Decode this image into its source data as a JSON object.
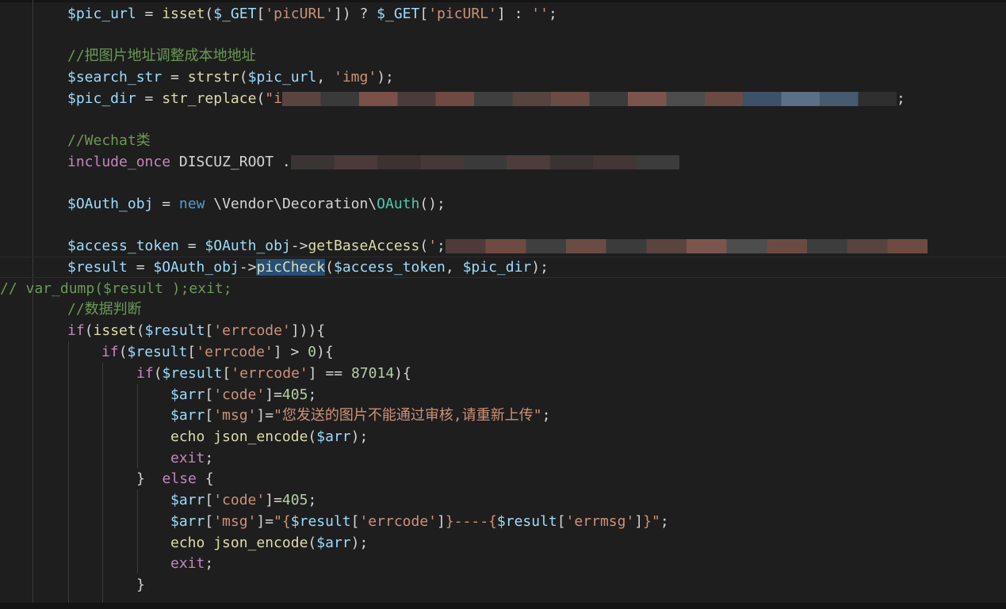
{
  "editor": {
    "theme_colors": {
      "background": "#1e1e1e",
      "variable": "#9cdcfe",
      "function": "#dcdcaa",
      "string": "#ce9178",
      "comment": "#6a9955",
      "keyword": "#569cd6",
      "control": "#c586c0",
      "class": "#4ec9b0",
      "number": "#b5cea8"
    },
    "highlighted_word": "picCheck",
    "lines": [
      {
        "id": "l1",
        "tokens": [
          [
            "v",
            "$pic_url"
          ],
          [
            "p",
            " = "
          ],
          [
            "f",
            "isset"
          ],
          [
            "p",
            "("
          ],
          [
            "v",
            "$_GET"
          ],
          [
            "p",
            "["
          ],
          [
            "s",
            "'picURL'"
          ],
          [
            "p",
            "]) ? "
          ],
          [
            "v",
            "$_GET"
          ],
          [
            "p",
            "["
          ],
          [
            "s",
            "'picURL'"
          ],
          [
            "p",
            "] : "
          ],
          [
            "s",
            "''"
          ],
          [
            "p",
            ";"
          ]
        ]
      },
      {
        "id": "l2",
        "tokens": [
          [
            "c",
            "//把图片地址调整成本地地址"
          ]
        ]
      },
      {
        "id": "l3",
        "tokens": [
          [
            "v",
            "$search_str"
          ],
          [
            "p",
            " = "
          ],
          [
            "f",
            "strstr"
          ],
          [
            "p",
            "("
          ],
          [
            "v",
            "$pic_url"
          ],
          [
            "p",
            ", "
          ],
          [
            "s",
            "'img'"
          ],
          [
            "p",
            ");"
          ]
        ]
      },
      {
        "id": "l4",
        "tokens": [
          [
            "v",
            "$pic_dir"
          ],
          [
            "p",
            " = "
          ],
          [
            "f",
            "str_replace"
          ],
          [
            "p",
            "("
          ],
          [
            "s",
            "\"i"
          ],
          [
            "p",
            ";"
          ]
        ]
      },
      {
        "id": "l5",
        "tokens": [
          [
            "c",
            "//Wechat类"
          ]
        ]
      },
      {
        "id": "l6",
        "tokens": [
          [
            "cf",
            "include_once"
          ],
          [
            "p",
            " DISCUZ_ROOT ."
          ]
        ]
      },
      {
        "id": "l7",
        "tokens": [
          [
            "v",
            "$OAuth_obj"
          ],
          [
            "p",
            " = "
          ],
          [
            "k",
            "new"
          ],
          [
            "p",
            " \\Vendor\\Decoration\\"
          ],
          [
            "cl",
            "OAuth"
          ],
          [
            "p",
            "();"
          ]
        ]
      },
      {
        "id": "l8",
        "tokens": [
          [
            "v",
            "$access_token"
          ],
          [
            "p",
            " = "
          ],
          [
            "v",
            "$OAuth_obj"
          ],
          [
            "p",
            "->"
          ],
          [
            "f",
            "getBaseAccess"
          ],
          [
            "p",
            "("
          ],
          [
            "s",
            "'"
          ],
          [
            "p",
            ";"
          ]
        ]
      },
      {
        "id": "l9",
        "tokens": [
          [
            "v",
            "$result"
          ],
          [
            "p",
            " = "
          ],
          [
            "v",
            "$OAuth_obj"
          ],
          [
            "p",
            "->"
          ],
          [
            "f",
            "picCheck"
          ],
          [
            "p",
            "("
          ],
          [
            "v",
            "$access_token"
          ],
          [
            "p",
            ", "
          ],
          [
            "v",
            "$pic_dir"
          ],
          [
            "p",
            ");"
          ]
        ]
      },
      {
        "id": "l10",
        "tokens": [
          [
            "c",
            "// var_dump($result );exit;"
          ]
        ]
      },
      {
        "id": "l11",
        "tokens": [
          [
            "c",
            "//数据判断"
          ]
        ]
      },
      {
        "id": "l12",
        "tokens": [
          [
            "cf",
            "if"
          ],
          [
            "p",
            "("
          ],
          [
            "f",
            "isset"
          ],
          [
            "p",
            "("
          ],
          [
            "v",
            "$result"
          ],
          [
            "p",
            "["
          ],
          [
            "s",
            "'errcode'"
          ],
          [
            "p",
            "])){"
          ]
        ]
      },
      {
        "id": "l13",
        "tokens": [
          [
            "cf",
            "if"
          ],
          [
            "p",
            "("
          ],
          [
            "v",
            "$result"
          ],
          [
            "p",
            "["
          ],
          [
            "s",
            "'errcode'"
          ],
          [
            "p",
            "] > "
          ],
          [
            "n",
            "0"
          ],
          [
            "p",
            "){"
          ]
        ]
      },
      {
        "id": "l14",
        "tokens": [
          [
            "cf",
            "if"
          ],
          [
            "p",
            "("
          ],
          [
            "v",
            "$result"
          ],
          [
            "p",
            "["
          ],
          [
            "s",
            "'errcode'"
          ],
          [
            "p",
            "] == "
          ],
          [
            "n",
            "87014"
          ],
          [
            "p",
            "){"
          ]
        ]
      },
      {
        "id": "l15",
        "tokens": [
          [
            "v",
            "$arr"
          ],
          [
            "p",
            "["
          ],
          [
            "s",
            "'code'"
          ],
          [
            "p",
            "]="
          ],
          [
            "n",
            "405"
          ],
          [
            "p",
            ";"
          ]
        ]
      },
      {
        "id": "l16",
        "tokens": [
          [
            "v",
            "$arr"
          ],
          [
            "p",
            "["
          ],
          [
            "s",
            "'msg'"
          ],
          [
            "p",
            "]="
          ],
          [
            "s",
            "\"您发送的图片不能通过审核,请重新上传\""
          ],
          [
            "p",
            ";"
          ]
        ]
      },
      {
        "id": "l17",
        "tokens": [
          [
            "f",
            "echo"
          ],
          [
            "p",
            " "
          ],
          [
            "f",
            "json_encode"
          ],
          [
            "p",
            "("
          ],
          [
            "v",
            "$arr"
          ],
          [
            "p",
            ");"
          ]
        ]
      },
      {
        "id": "l18",
        "tokens": [
          [
            "cf",
            "exit"
          ],
          [
            "p",
            ";"
          ]
        ]
      },
      {
        "id": "l19",
        "tokens": [
          [
            "p",
            "}  "
          ],
          [
            "cf",
            "else"
          ],
          [
            "p",
            " {"
          ]
        ]
      },
      {
        "id": "l20",
        "tokens": [
          [
            "v",
            "$arr"
          ],
          [
            "p",
            "["
          ],
          [
            "s",
            "'code'"
          ],
          [
            "p",
            "]="
          ],
          [
            "n",
            "405"
          ],
          [
            "p",
            ";"
          ]
        ]
      },
      {
        "id": "l21",
        "tokens": [
          [
            "v",
            "$arr"
          ],
          [
            "p",
            "["
          ],
          [
            "s",
            "'msg'"
          ],
          [
            "p",
            "]="
          ],
          [
            "s",
            "\"{"
          ],
          [
            "v",
            "$result"
          ],
          [
            "p",
            "["
          ],
          [
            "s",
            "'errcode'"
          ],
          [
            "p",
            "]"
          ],
          [
            "s",
            "}----{"
          ],
          [
            "v",
            "$result"
          ],
          [
            "p",
            "["
          ],
          [
            "s",
            "'errmsg'"
          ],
          [
            "p",
            "]"
          ],
          [
            "s",
            "}\""
          ],
          [
            "p",
            ";"
          ]
        ]
      },
      {
        "id": "l22",
        "tokens": [
          [
            "f",
            "echo"
          ],
          [
            "p",
            " "
          ],
          [
            "f",
            "json_encode"
          ],
          [
            "p",
            "("
          ],
          [
            "v",
            "$arr"
          ],
          [
            "p",
            ");"
          ]
        ]
      },
      {
        "id": "l23",
        "tokens": [
          [
            "cf",
            "exit"
          ],
          [
            "p",
            ";"
          ]
        ]
      },
      {
        "id": "l24",
        "tokens": [
          [
            "p",
            "}"
          ]
        ]
      }
    ]
  }
}
